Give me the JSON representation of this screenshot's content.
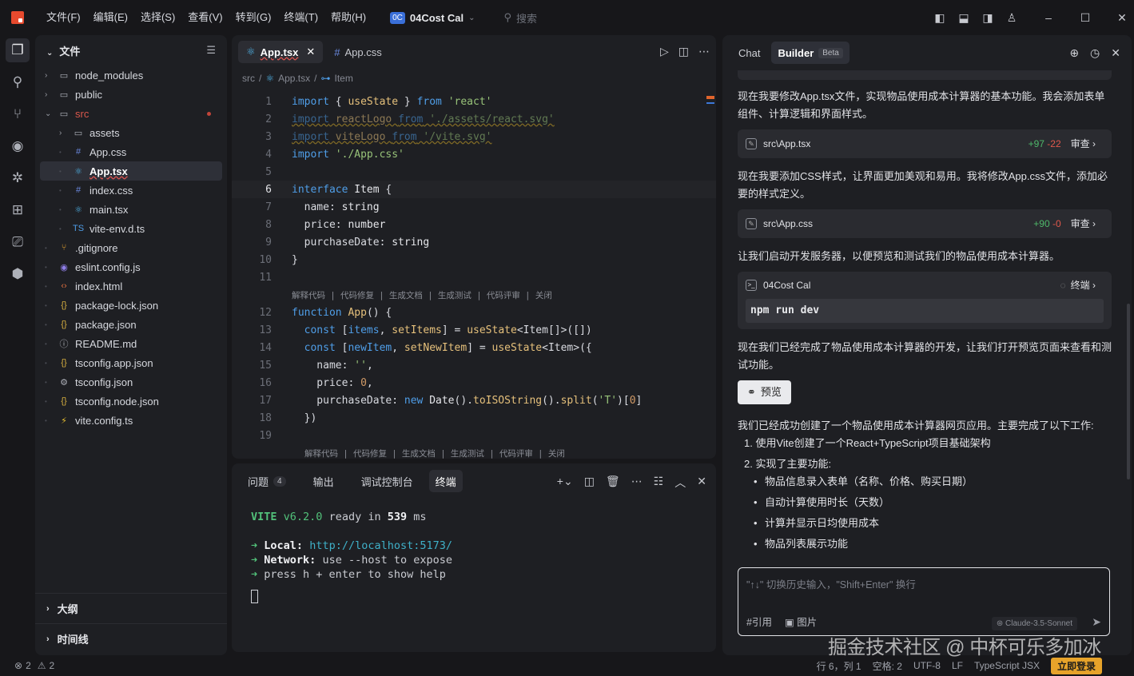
{
  "menu": [
    "文件(F)",
    "编辑(E)",
    "选择(S)",
    "查看(V)",
    "转到(G)",
    "终端(T)",
    "帮助(H)"
  ],
  "project": {
    "badge": "0C",
    "name": "04Cost Cal"
  },
  "search_placeholder": "搜索",
  "sidebar": {
    "title": "文件",
    "items": [
      {
        "label": "node_modules",
        "icon": "folder-icon",
        "depth": 0,
        "chev": "›"
      },
      {
        "label": "public",
        "icon": "folder-icon",
        "depth": 0,
        "chev": "›"
      },
      {
        "label": "src",
        "icon": "folder-icon",
        "depth": 0,
        "chev": "⌄",
        "modified": true
      },
      {
        "label": "assets",
        "icon": "folder-icon",
        "depth": 1,
        "chev": "›"
      },
      {
        "label": "App.css",
        "icon": "hash-icon",
        "depth": 1
      },
      {
        "label": "App.tsx",
        "icon": "react-icon",
        "depth": 1,
        "selected": true
      },
      {
        "label": "index.css",
        "icon": "hash-icon",
        "depth": 1
      },
      {
        "label": "main.tsx",
        "icon": "react-icon",
        "depth": 1
      },
      {
        "label": "vite-env.d.ts",
        "icon": "ts-icon",
        "depth": 1
      },
      {
        "label": ".gitignore",
        "icon": "git-icon",
        "depth": 0
      },
      {
        "label": "eslint.config.js",
        "icon": "eslint-icon",
        "depth": 0
      },
      {
        "label": "index.html",
        "icon": "html-icon",
        "depth": 0
      },
      {
        "label": "package-lock.json",
        "icon": "json-icon",
        "depth": 0
      },
      {
        "label": "package.json",
        "icon": "json-icon",
        "depth": 0
      },
      {
        "label": "README.md",
        "icon": "info-icon",
        "depth": 0
      },
      {
        "label": "tsconfig.app.json",
        "icon": "json-icon",
        "depth": 0
      },
      {
        "label": "tsconfig.json",
        "icon": "gear-icon",
        "depth": 0
      },
      {
        "label": "tsconfig.node.json",
        "icon": "json-icon",
        "depth": 0
      },
      {
        "label": "vite.config.ts",
        "icon": "vite-icon",
        "depth": 0
      }
    ],
    "outline": "大纲",
    "timeline": "时间线"
  },
  "editor": {
    "tabs": [
      {
        "label": "App.tsx",
        "active": true
      },
      {
        "label": "App.css",
        "active": false
      }
    ],
    "breadcrumb": [
      "src",
      "App.tsx",
      "Item"
    ],
    "codelens": "解释代码 | 代码修复 | 生成文档 | 生成测试 | 代码评审 | 关闭"
  },
  "panel": {
    "tabs": [
      {
        "label": "问题",
        "count": "4"
      },
      {
        "label": "输出"
      },
      {
        "label": "调试控制台"
      },
      {
        "label": "终端",
        "active": true
      }
    ],
    "terminal": {
      "vite": "VITE",
      "version": "v6.2.0",
      "ready": "ready in",
      "ms_value": "539",
      "ms": "ms",
      "local_label": "Local:",
      "local_url": "http://localhost:5173/",
      "network_label": "Network:",
      "network_text": "use --host to expose",
      "help_text": "press h + enter to show help"
    }
  },
  "chat": {
    "tabs": [
      "Chat",
      "Builder"
    ],
    "beta": "Beta",
    "msg1": "现在我要修改App.tsx文件，实现物品使用成本计算器的基本功能。我会添加表单组件、计算逻辑和界面样式。",
    "file1": {
      "name": "src\\App.tsx",
      "add": "+97",
      "del": "-22",
      "review": "审查"
    },
    "msg2": "现在我要添加CSS样式，让界面更加美观和易用。我将修改App.css文件，添加必要的样式定义。",
    "file2": {
      "name": "src\\App.css",
      "add": "+90",
      "del": "-0",
      "review": "审查"
    },
    "msg3": "让我们启动开发服务器，以便预览和测试我们的物品使用成本计算器。",
    "terminal_card": {
      "name": "04Cost Cal",
      "status": "终端",
      "cmd": "npm run dev"
    },
    "msg4": "现在我们已经完成了物品使用成本计算器的开发，让我们打开预览页面来查看和测试功能。",
    "preview": "预览",
    "msg5": "我们已经成功创建了一个物品使用成本计算器网页应用。主要完成了以下工作:",
    "list1": "1. 使用Vite创建了一个React+TypeScript项目基础架构",
    "list2": "2. 实现了主要功能:",
    "bullets": [
      "物品信息录入表单（名称、价格、购买日期）",
      "自动计算使用时长（天数）",
      "计算并显示日均使用成本",
      "物品列表展示功能"
    ],
    "input_placeholder": "\"↑↓\" 切换历史输入，\"Shift+Enter\" 换行",
    "ref": "#引用",
    "image": "图片",
    "model": "Claude-3.5-Sonnet"
  },
  "status": {
    "errors": "2",
    "warnings": "2",
    "pos": "行 6，列 1",
    "spaces": "空格: 2",
    "enc": "UTF-8",
    "eol": "LF",
    "lang": "TypeScript JSX",
    "login": "立即登录"
  },
  "watermark": "掘金技术社区 @ 中杯可乐多加冰"
}
